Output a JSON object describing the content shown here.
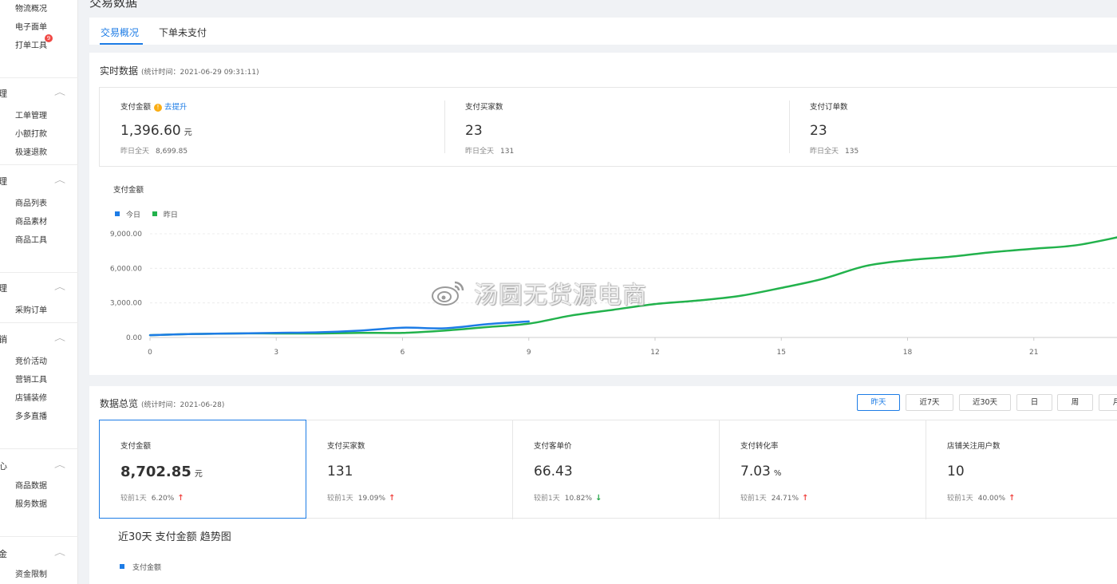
{
  "sidebar": {
    "groups": [
      {
        "title": "",
        "items": [
          "物流概况",
          "电子面单",
          "打单工具"
        ]
      },
      {
        "title": "理",
        "items": [
          "工单管理",
          "小额打款",
          "极速退款"
        ]
      },
      {
        "title": "理",
        "items": [
          "商品列表",
          "商品素材",
          "商品工具"
        ]
      },
      {
        "title": "理",
        "items": [
          "采购订单"
        ]
      },
      {
        "title": "销",
        "items": [
          "竞价活动",
          "营销工具",
          "店铺装修",
          "多多直播"
        ]
      },
      {
        "title": "心",
        "items": [
          "商品数据",
          "服务数据"
        ]
      },
      {
        "title": "金",
        "items": [
          "资金限制"
        ]
      }
    ],
    "badge": "9"
  },
  "page_title": "交易数据",
  "tabs": [
    {
      "label": "交易概况",
      "active": true
    },
    {
      "label": "下单未支付",
      "active": false
    }
  ],
  "realtime": {
    "title": "实时数据",
    "subtitle": "(统计时间：2021-06-29 09:31:11)",
    "metrics": [
      {
        "label": "支付金额",
        "value": "1,396.60",
        "unit": "元",
        "compare_label": "昨日全天",
        "compare_value": "8,699.85",
        "link": "去提升"
      },
      {
        "label": "支付买家数",
        "value": "23",
        "unit": "",
        "compare_label": "昨日全天",
        "compare_value": "131"
      },
      {
        "label": "支付订单数",
        "value": "23",
        "unit": "",
        "compare_label": "昨日全天",
        "compare_value": "135"
      }
    ],
    "chart_title": "支付金额",
    "legend": {
      "today": "今日",
      "yesterday": "昨日"
    }
  },
  "chart_data": {
    "type": "line",
    "title": "支付金额",
    "xlabel": "",
    "ylabel": "",
    "x_ticks": [
      "0",
      "3",
      "6",
      "9",
      "12",
      "15",
      "18",
      "21"
    ],
    "y_ticks": [
      "0.00",
      "3,000.00",
      "6,000.00",
      "9,000.00"
    ],
    "ylim": [
      0,
      9000
    ],
    "xlim": [
      0,
      23
    ],
    "grid": true,
    "legend_position": "top-left",
    "series": [
      {
        "name": "今日",
        "color": "#1d7ce6",
        "x": [
          0,
          1,
          2,
          3,
          4,
          5,
          6,
          7,
          8,
          9
        ],
        "y": [
          200,
          300,
          350,
          400,
          450,
          600,
          850,
          800,
          1150,
          1397
        ]
      },
      {
        "name": "昨日",
        "color": "#22b24c",
        "x": [
          0,
          1,
          2,
          3,
          4,
          5,
          6,
          7,
          8,
          9,
          10,
          11,
          12,
          13,
          14,
          15,
          16,
          17,
          18,
          19,
          20,
          21,
          22,
          23
        ],
        "y": [
          200,
          300,
          350,
          350,
          350,
          400,
          400,
          600,
          900,
          1200,
          1900,
          2400,
          2900,
          3200,
          3600,
          4300,
          5100,
          6200,
          6700,
          7000,
          7400,
          7700,
          8000,
          8700
        ]
      }
    ]
  },
  "overview": {
    "title": "数据总览",
    "subtitle": "(统计时间：2021-06-28)",
    "buttons": [
      {
        "label": "昨天",
        "active": true
      },
      {
        "label": "近7天",
        "active": false
      },
      {
        "label": "近30天",
        "active": false
      },
      {
        "label": "日",
        "active": false
      },
      {
        "label": "周",
        "active": false
      },
      {
        "label": "月",
        "active": false
      }
    ],
    "metrics": [
      {
        "label": "支付金额",
        "value": "8,702.85",
        "unit": "元",
        "compare_label": "较前1天",
        "compare_value": "6.20%",
        "direction": "up"
      },
      {
        "label": "支付买家数",
        "value": "131",
        "unit": "",
        "compare_label": "较前1天",
        "compare_value": "19.09%",
        "direction": "up"
      },
      {
        "label": "支付客单价",
        "value": "66.43",
        "unit": "",
        "compare_label": "较前1天",
        "compare_value": "10.82%",
        "direction": "down"
      },
      {
        "label": "支付转化率",
        "value": "7.03",
        "unit": "%",
        "compare_label": "较前1天",
        "compare_value": "24.71%",
        "direction": "up"
      },
      {
        "label": "店铺关注用户数",
        "value": "10",
        "unit": "",
        "compare_label": "较前1天",
        "compare_value": "40.00%",
        "direction": "up"
      }
    ],
    "trend_title": "近30天 支付金额 趋势图",
    "trend_legend": "支付金额"
  },
  "watermark": "汤圆无货源电商",
  "colors": {
    "accent": "#1d7ce6",
    "today_line": "#1d7ce6",
    "yesterday_line": "#22b24c",
    "up": "#f04844",
    "down": "#22a447",
    "warn": "#faad14"
  }
}
